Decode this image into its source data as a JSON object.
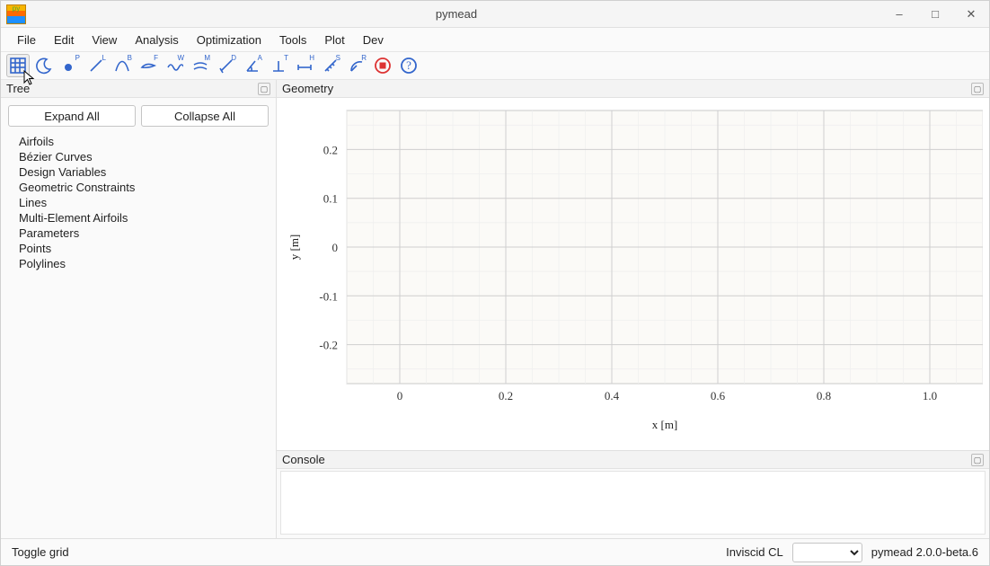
{
  "window": {
    "title": "pymead"
  },
  "menubar": [
    "File",
    "Edit",
    "View",
    "Analysis",
    "Optimization",
    "Tools",
    "Plot",
    "Dev"
  ],
  "toolbar_letters": [
    "P",
    "L",
    "B",
    "F",
    "W",
    "M",
    "D",
    "A",
    "T",
    "H",
    "S",
    "R"
  ],
  "panes": {
    "tree_title": "Tree",
    "geometry_title": "Geometry",
    "console_title": "Console"
  },
  "tree": {
    "expand": "Expand All",
    "collapse": "Collapse All",
    "items": [
      "Airfoils",
      "Bézier Curves",
      "Design Variables",
      "Geometric Constraints",
      "Lines",
      "Multi-Element Airfoils",
      "Parameters",
      "Points",
      "Polylines"
    ]
  },
  "status": {
    "left": "Toggle grid",
    "cl_label": "Inviscid CL",
    "version": "pymead 2.0.0-beta.6"
  },
  "chart_data": {
    "type": "scatter",
    "title": "",
    "xlabel": "x [m]",
    "ylabel": "y [m]",
    "xlim": [
      -0.1,
      1.1
    ],
    "ylim": [
      -0.28,
      0.28
    ],
    "xticks": [
      0,
      0.2,
      0.4,
      0.6,
      0.8,
      1.0
    ],
    "yticks": [
      -0.2,
      -0.1,
      0,
      0.1,
      0.2
    ],
    "series": []
  }
}
